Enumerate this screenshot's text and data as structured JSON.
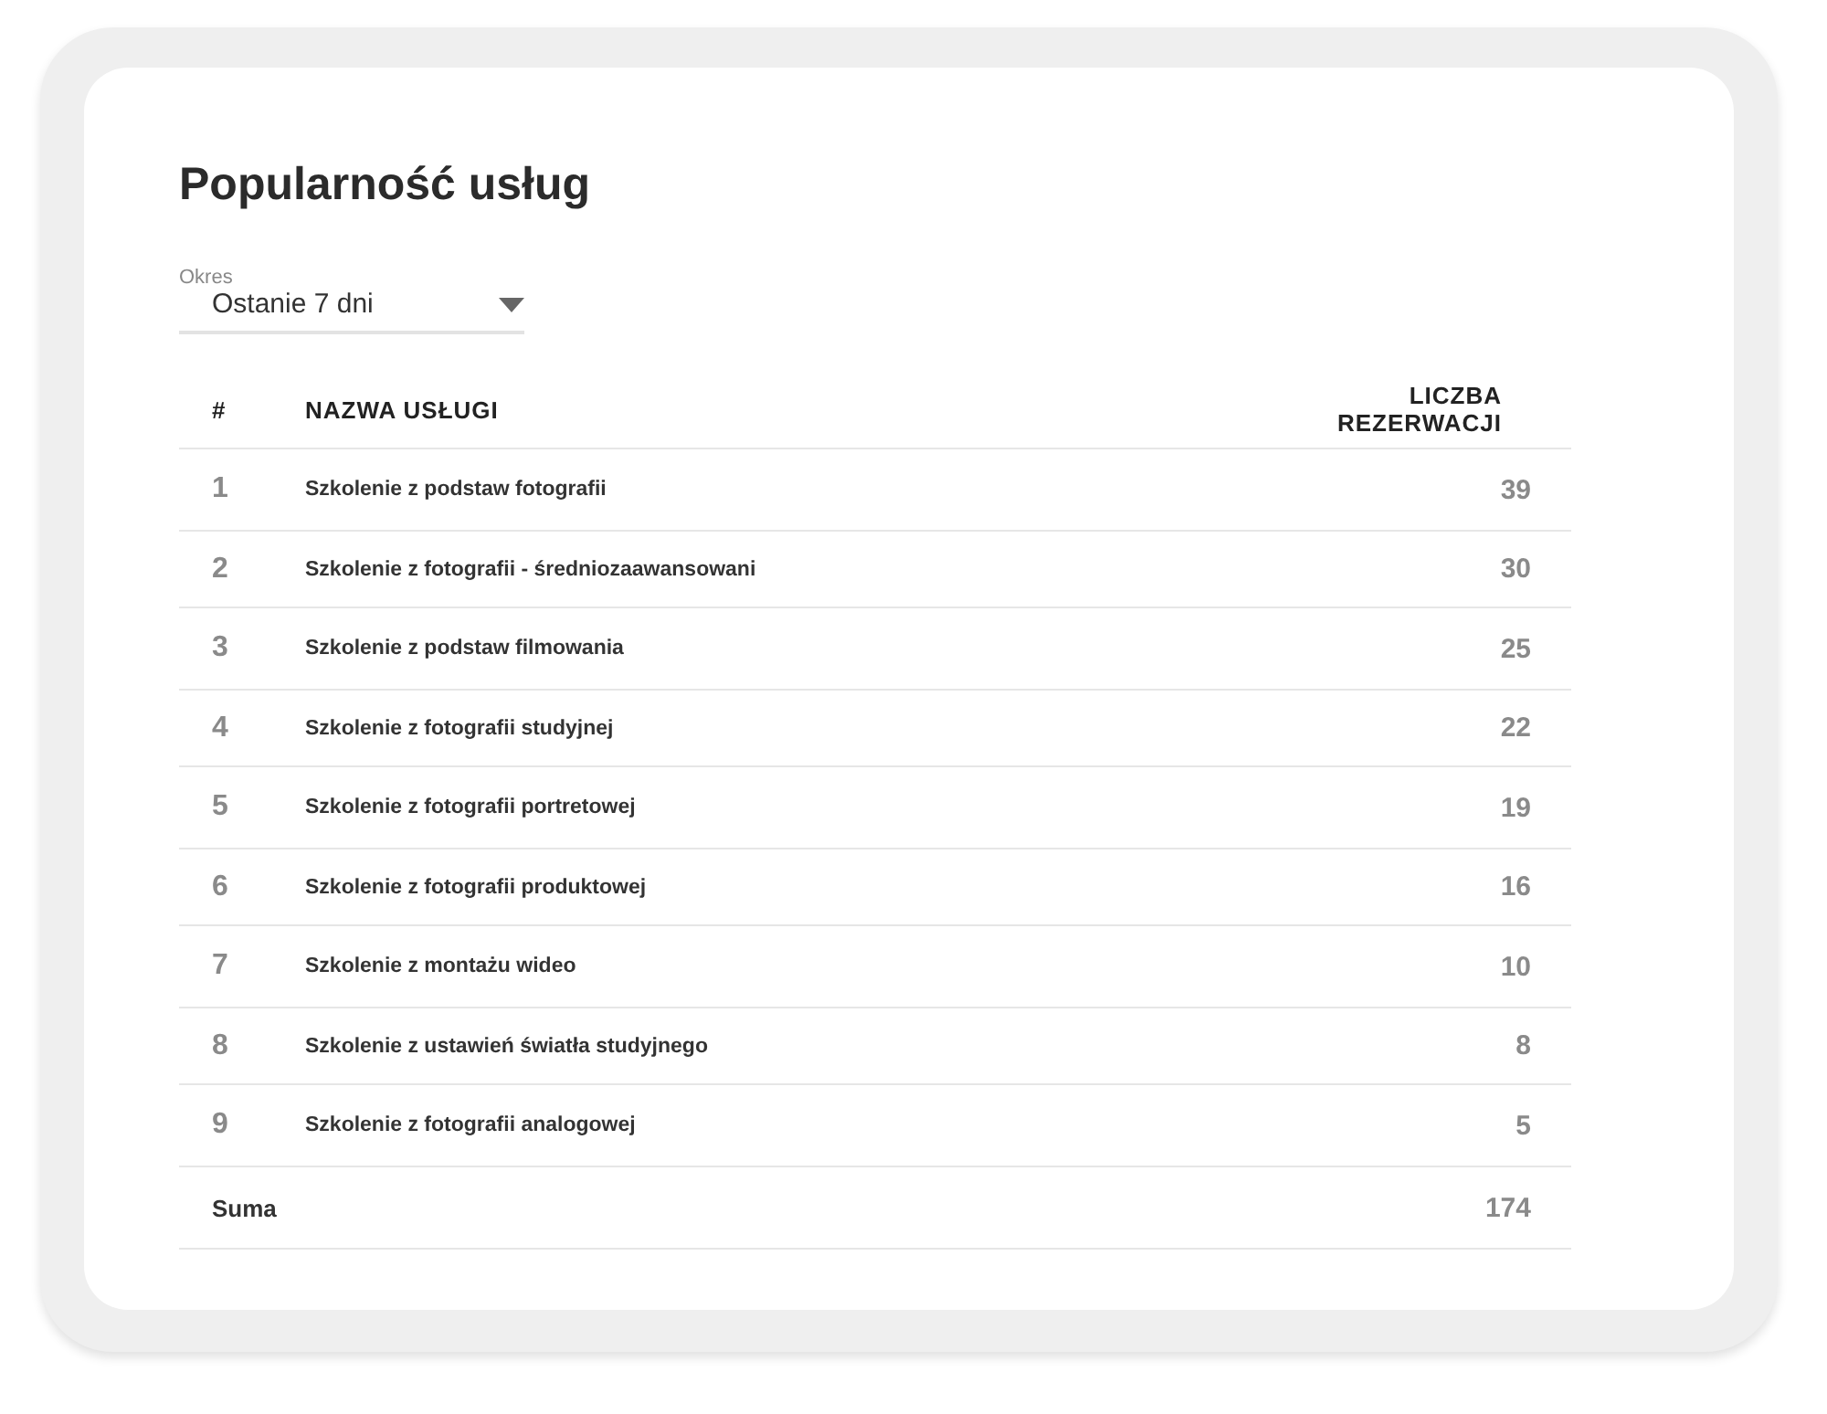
{
  "title": "Popularność usług",
  "period": {
    "label": "Okres",
    "value": "Ostanie 7 dni"
  },
  "table": {
    "columns": [
      "#",
      "NAZWA USŁUGI",
      "LICZBA REZERWACJI"
    ],
    "rows": [
      {
        "rank": "1",
        "name": "Szkolenie z podstaw fotografii",
        "count": "39"
      },
      {
        "rank": "2",
        "name": "Szkolenie z fotografii - średniozaawansowani",
        "count": "30"
      },
      {
        "rank": "3",
        "name": "Szkolenie z podstaw filmowania",
        "count": "25"
      },
      {
        "rank": "4",
        "name": "Szkolenie z fotografii studyjnej",
        "count": "22"
      },
      {
        "rank": "5",
        "name": "Szkolenie z fotografii portretowej",
        "count": "19"
      },
      {
        "rank": "6",
        "name": "Szkolenie z fotografii produktowej",
        "count": "16"
      },
      {
        "rank": "7",
        "name": "Szkolenie z montażu wideo",
        "count": "10"
      },
      {
        "rank": "8",
        "name": "Szkolenie z ustawień światła studyjnego",
        "count": "8"
      },
      {
        "rank": "9",
        "name": "Szkolenie z fotografii analogowej",
        "count": "5"
      }
    ],
    "total": {
      "label": "Suma",
      "count": "174"
    }
  }
}
